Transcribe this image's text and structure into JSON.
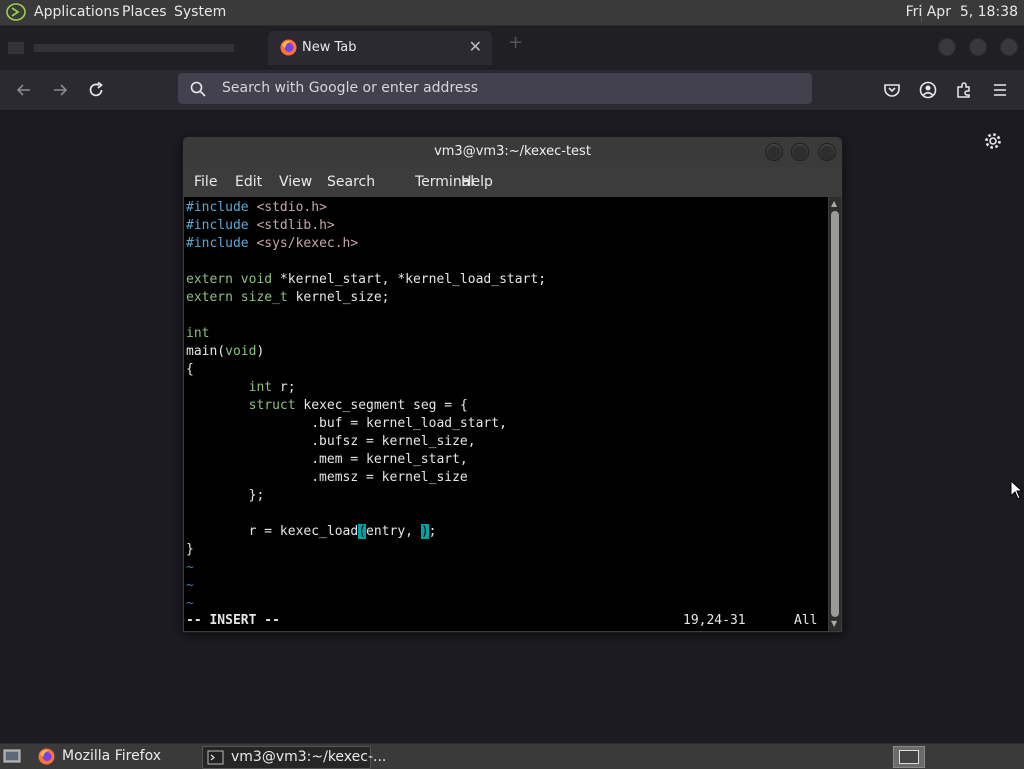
{
  "top_panel": {
    "applications": "Applications",
    "places": "Places",
    "system": "System",
    "clock": "Fri Apr  5, 18:38"
  },
  "browser": {
    "tab_title": "New Tab",
    "tab_close": "✕",
    "url_placeholder": "Search with Google or enter address",
    "accent": "#42414d"
  },
  "terminal": {
    "title": "vm3@vm3:~/kexec-test",
    "menu": [
      "File",
      "Edit",
      "View",
      "Search",
      "Terminal",
      "Help"
    ],
    "code": {
      "l1_dir": "#include",
      "l1_file": " <stdio.h>",
      "l2_dir": "#include",
      "l2_file": " <stdlib.h>",
      "l3_dir": "#include",
      "l3_file": " <sys/kexec.h>",
      "l5_kw": "extern void",
      "l5_rest": " *kernel_start, *kernel_load_start;",
      "l6_kw": "extern size_t",
      "l6_rest": " kernel_size;",
      "l8_kw": "int",
      "l9_a": "main(",
      "l9_kw": "void",
      "l9_b": ")",
      "l10": "{",
      "l11_indent": "        ",
      "l11_kw": "int",
      "l11_rest": " r;",
      "l12_indent": "        ",
      "l12_kw": "struct",
      "l12_rest": " kexec_segment seg = {",
      "l13": "                .buf = kernel_load_start,",
      "l14": "                .bufsz = kernel_size,",
      "l15": "                .mem = kernel_start,",
      "l16": "                .memsz = kernel_size",
      "l17": "        };",
      "l19_a": "        r = kexec_load",
      "l19_paren": "(",
      "l19_b": "entry, ",
      "l19_cur": ")",
      "l19_c": ";",
      "l20": "}",
      "tilde": "~"
    },
    "status_mode": "-- INSERT --",
    "status_pos": "19,24-31",
    "status_pct": "All"
  },
  "taskbar": {
    "firefox_label": "Mozilla Firefox",
    "terminal_label": "vm3@vm3:~/kexec-..."
  }
}
